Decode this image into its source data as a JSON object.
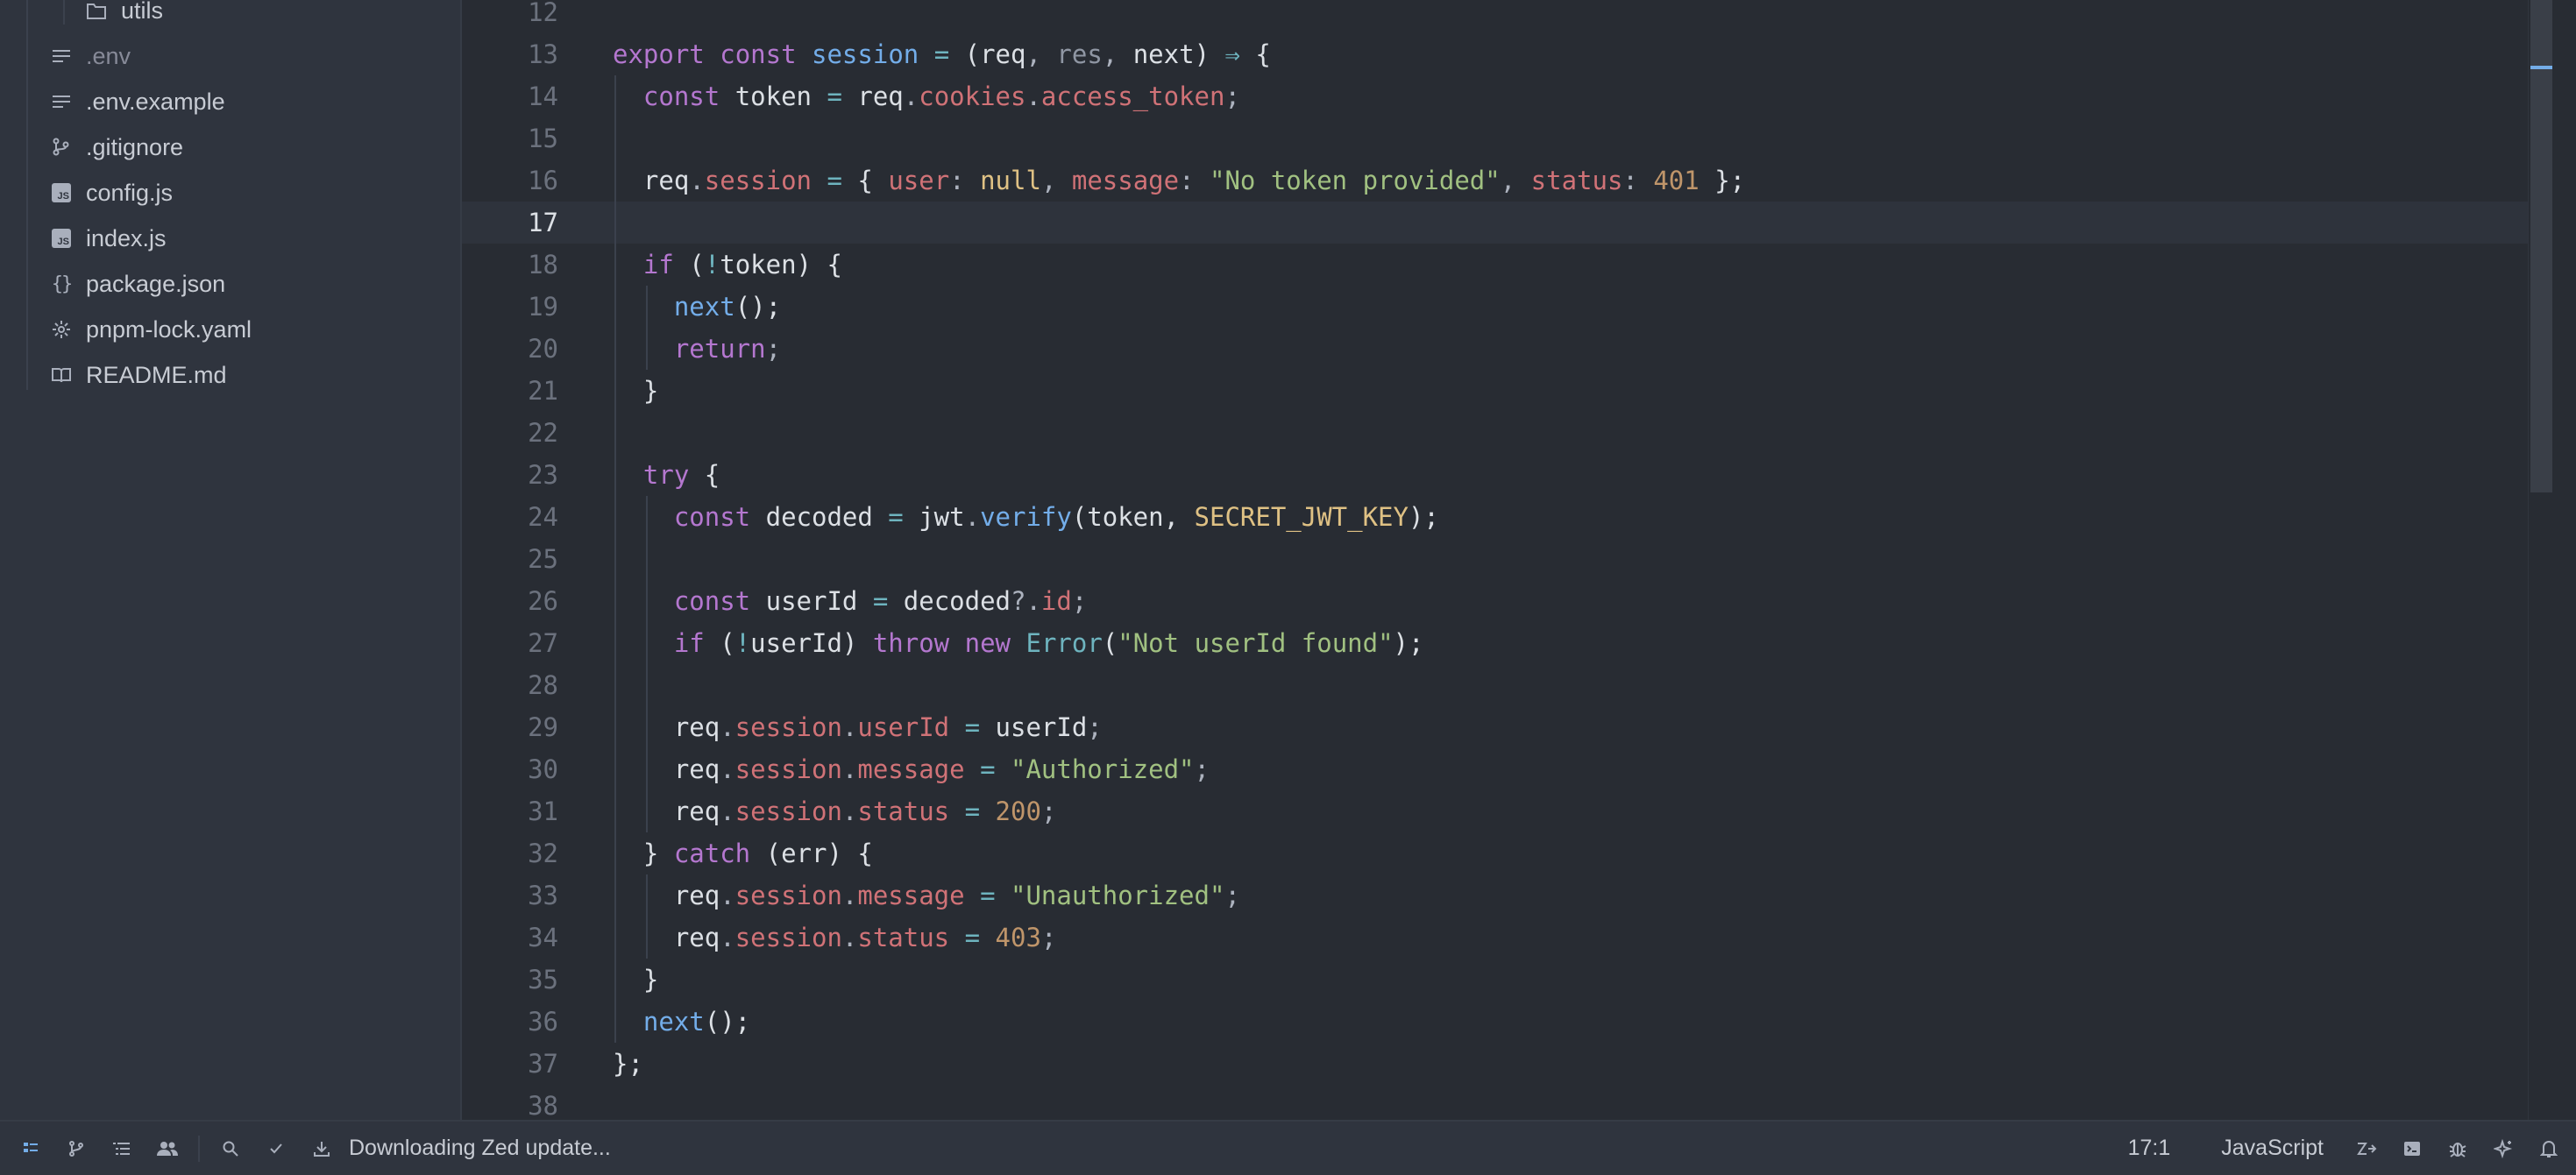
{
  "sidebar": {
    "items": [
      {
        "label": "utils",
        "icon": "folder-icon",
        "indent": "sub",
        "dim": false
      },
      {
        "label": ".env",
        "icon": "text-file-icon",
        "dim": true
      },
      {
        "label": ".env.example",
        "icon": "text-file-icon",
        "dim": false
      },
      {
        "label": ".gitignore",
        "icon": "git-icon",
        "dim": false
      },
      {
        "label": "config.js",
        "icon": "js-file-icon",
        "dim": false
      },
      {
        "label": "index.js",
        "icon": "js-file-icon",
        "dim": false
      },
      {
        "label": "package.json",
        "icon": "json-braces-icon",
        "dim": false
      },
      {
        "label": "pnpm-lock.yaml",
        "icon": "gear-file-icon",
        "dim": false
      },
      {
        "label": "README.md",
        "icon": "book-icon",
        "dim": false
      }
    ]
  },
  "editor": {
    "active_line": "17",
    "lines": [
      {
        "n": "12",
        "tokens": []
      },
      {
        "n": "13",
        "tokens": [
          [
            "kw",
            "export"
          ],
          [
            "",
            ""
          ],
          [
            "t",
            " "
          ],
          [
            "kw",
            "const"
          ],
          [
            "t",
            " "
          ],
          [
            "fn",
            "session"
          ],
          [
            "t",
            " "
          ],
          [
            "op",
            "="
          ],
          [
            "t",
            " ("
          ],
          [
            "t",
            "req"
          ],
          [
            "punc",
            ", "
          ],
          [
            "dim",
            "res"
          ],
          [
            "punc",
            ", "
          ],
          [
            "t",
            "next"
          ],
          [
            "t",
            ") "
          ],
          [
            "op",
            "⇒"
          ],
          [
            "t",
            " {"
          ]
        ]
      },
      {
        "n": "14",
        "tokens": [
          [
            "t",
            "  "
          ],
          [
            "kw",
            "const"
          ],
          [
            "t",
            " token "
          ],
          [
            "op",
            "="
          ],
          [
            "t",
            " req"
          ],
          [
            "punc",
            "."
          ],
          [
            "prop",
            "cookies"
          ],
          [
            "punc",
            "."
          ],
          [
            "prop",
            "access_token"
          ],
          [
            "punc",
            ";"
          ]
        ]
      },
      {
        "n": "15",
        "tokens": []
      },
      {
        "n": "16",
        "tokens": [
          [
            "t",
            "  req"
          ],
          [
            "punc",
            "."
          ],
          [
            "prop",
            "session"
          ],
          [
            "t",
            " "
          ],
          [
            "op",
            "="
          ],
          [
            "t",
            " { "
          ],
          [
            "prop",
            "user"
          ],
          [
            "punc",
            ": "
          ],
          [
            "const",
            "null"
          ],
          [
            "punc",
            ", "
          ],
          [
            "prop",
            "message"
          ],
          [
            "punc",
            ": "
          ],
          [
            "str",
            "\"No token provided\""
          ],
          [
            "punc",
            ", "
          ],
          [
            "prop",
            "status"
          ],
          [
            "punc",
            ": "
          ],
          [
            "num",
            "401"
          ],
          [
            "t",
            " };"
          ]
        ]
      },
      {
        "n": "17",
        "tokens": []
      },
      {
        "n": "18",
        "tokens": [
          [
            "t",
            "  "
          ],
          [
            "kw",
            "if"
          ],
          [
            "t",
            " ("
          ],
          [
            "op",
            "!"
          ],
          [
            "t",
            "token) {"
          ]
        ]
      },
      {
        "n": "19",
        "tokens": [
          [
            "t",
            "    "
          ],
          [
            "fn",
            "next"
          ],
          [
            "t",
            "();"
          ]
        ]
      },
      {
        "n": "20",
        "tokens": [
          [
            "t",
            "    "
          ],
          [
            "kw",
            "return"
          ],
          [
            "punc",
            ";"
          ]
        ]
      },
      {
        "n": "21",
        "tokens": [
          [
            "t",
            "  }"
          ]
        ]
      },
      {
        "n": "22",
        "tokens": []
      },
      {
        "n": "23",
        "tokens": [
          [
            "t",
            "  "
          ],
          [
            "kw",
            "try"
          ],
          [
            "t",
            " {"
          ]
        ]
      },
      {
        "n": "24",
        "tokens": [
          [
            "t",
            "    "
          ],
          [
            "kw",
            "const"
          ],
          [
            "t",
            " decoded "
          ],
          [
            "op",
            "="
          ],
          [
            "t",
            " jwt"
          ],
          [
            "punc",
            "."
          ],
          [
            "fn",
            "verify"
          ],
          [
            "t",
            "(token, "
          ],
          [
            "const",
            "SECRET_JWT_KEY"
          ],
          [
            "t",
            ");"
          ]
        ]
      },
      {
        "n": "25",
        "tokens": []
      },
      {
        "n": "26",
        "tokens": [
          [
            "t",
            "    "
          ],
          [
            "kw",
            "const"
          ],
          [
            "t",
            " userId "
          ],
          [
            "op",
            "="
          ],
          [
            "t",
            " decoded"
          ],
          [
            "punc",
            "?."
          ],
          [
            "prop",
            "id"
          ],
          [
            "punc",
            ";"
          ]
        ]
      },
      {
        "n": "27",
        "tokens": [
          [
            "t",
            "    "
          ],
          [
            "kw",
            "if"
          ],
          [
            "t",
            " ("
          ],
          [
            "op",
            "!"
          ],
          [
            "t",
            "userId) "
          ],
          [
            "kw",
            "throw"
          ],
          [
            "t",
            " "
          ],
          [
            "kw",
            "new"
          ],
          [
            "t",
            " "
          ],
          [
            "type",
            "Error"
          ],
          [
            "t",
            "("
          ],
          [
            "str",
            "\"Not userId found\""
          ],
          [
            "t",
            ");"
          ]
        ]
      },
      {
        "n": "28",
        "tokens": []
      },
      {
        "n": "29",
        "tokens": [
          [
            "t",
            "    req"
          ],
          [
            "punc",
            "."
          ],
          [
            "prop",
            "session"
          ],
          [
            "punc",
            "."
          ],
          [
            "prop",
            "userId"
          ],
          [
            "t",
            " "
          ],
          [
            "op",
            "="
          ],
          [
            "t",
            " userId"
          ],
          [
            "punc",
            ";"
          ]
        ]
      },
      {
        "n": "30",
        "tokens": [
          [
            "t",
            "    req"
          ],
          [
            "punc",
            "."
          ],
          [
            "prop",
            "session"
          ],
          [
            "punc",
            "."
          ],
          [
            "prop",
            "message"
          ],
          [
            "t",
            " "
          ],
          [
            "op",
            "="
          ],
          [
            "t",
            " "
          ],
          [
            "str",
            "\"Authorized\""
          ],
          [
            "punc",
            ";"
          ]
        ]
      },
      {
        "n": "31",
        "tokens": [
          [
            "t",
            "    req"
          ],
          [
            "punc",
            "."
          ],
          [
            "prop",
            "session"
          ],
          [
            "punc",
            "."
          ],
          [
            "prop",
            "status"
          ],
          [
            "t",
            " "
          ],
          [
            "op",
            "="
          ],
          [
            "t",
            " "
          ],
          [
            "num",
            "200"
          ],
          [
            "punc",
            ";"
          ]
        ]
      },
      {
        "n": "32",
        "tokens": [
          [
            "t",
            "  } "
          ],
          [
            "kw",
            "catch"
          ],
          [
            "t",
            " (err) {"
          ]
        ]
      },
      {
        "n": "33",
        "tokens": [
          [
            "t",
            "    req"
          ],
          [
            "punc",
            "."
          ],
          [
            "prop",
            "session"
          ],
          [
            "punc",
            "."
          ],
          [
            "prop",
            "message"
          ],
          [
            "t",
            " "
          ],
          [
            "op",
            "="
          ],
          [
            "t",
            " "
          ],
          [
            "str",
            "\"Unauthorized\""
          ],
          [
            "punc",
            ";"
          ]
        ]
      },
      {
        "n": "34",
        "tokens": [
          [
            "t",
            "    req"
          ],
          [
            "punc",
            "."
          ],
          [
            "prop",
            "session"
          ],
          [
            "punc",
            "."
          ],
          [
            "prop",
            "status"
          ],
          [
            "t",
            " "
          ],
          [
            "op",
            "="
          ],
          [
            "t",
            " "
          ],
          [
            "num",
            "403"
          ],
          [
            "punc",
            ";"
          ]
        ]
      },
      {
        "n": "35",
        "tokens": [
          [
            "t",
            "  }"
          ]
        ]
      },
      {
        "n": "36",
        "tokens": [
          [
            "t",
            "  "
          ],
          [
            "fn",
            "next"
          ],
          [
            "t",
            "();"
          ]
        ]
      },
      {
        "n": "37",
        "tokens": [
          [
            "t",
            "};"
          ]
        ]
      },
      {
        "n": "38",
        "tokens": []
      }
    ]
  },
  "statusbar": {
    "left_icons": [
      "project-panel-icon",
      "git-branch-icon",
      "outline-icon",
      "collab-icon",
      "search-icon",
      "check-icon",
      "download-icon"
    ],
    "message": "Downloading Zed update...",
    "cursor_position": "17:1",
    "language": "JavaScript",
    "right_icons": [
      "language-switch-icon",
      "terminal-icon",
      "debug-icon",
      "assistant-icon",
      "bell-icon"
    ]
  },
  "colors": {
    "accent": "#74ade8",
    "keyword": "#b477cf",
    "function": "#73ade9",
    "property": "#d07277",
    "string": "#a1c181",
    "number": "#bf956a",
    "constant": "#dfc184"
  }
}
